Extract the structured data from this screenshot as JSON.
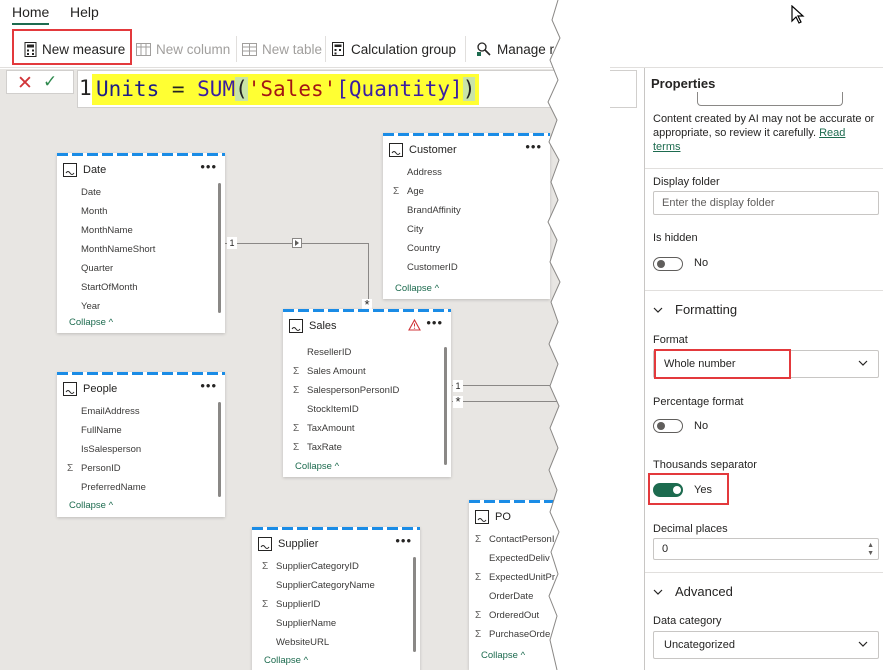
{
  "menu": {
    "tabs": [
      {
        "label": "Home",
        "active": true
      },
      {
        "label": "Help",
        "active": false
      }
    ]
  },
  "ribbon": {
    "new_measure": "New measure",
    "new_column": "New column",
    "new_table": "New table",
    "calculation_group": "Calculation group",
    "manage": "Manage r"
  },
  "formula": {
    "line_number": "1",
    "tokens": {
      "var": "Units",
      "eq": " = ",
      "fn": "SUM",
      "open": "(",
      "table": "'Sales'",
      "col": "[Quantity]",
      "close": ")"
    }
  },
  "tables": {
    "date": {
      "title": "Date",
      "fields": [
        {
          "name": "Date",
          "sigma": false
        },
        {
          "name": "Month",
          "sigma": false
        },
        {
          "name": "MonthName",
          "sigma": false
        },
        {
          "name": "MonthNameShort",
          "sigma": false
        },
        {
          "name": "Quarter",
          "sigma": false
        },
        {
          "name": "StartOfMonth",
          "sigma": false
        },
        {
          "name": "Year",
          "sigma": false
        }
      ],
      "collapse": "Collapse"
    },
    "customer": {
      "title": "Customer",
      "fields": [
        {
          "name": "Address",
          "sigma": false
        },
        {
          "name": "Age",
          "sigma": true
        },
        {
          "name": "BrandAffinity",
          "sigma": false
        },
        {
          "name": "City",
          "sigma": false
        },
        {
          "name": "Country",
          "sigma": false
        },
        {
          "name": "CustomerID",
          "sigma": false
        }
      ],
      "collapse": "Collapse"
    },
    "sales": {
      "title": "Sales",
      "fields": [
        {
          "name": "ResellerID",
          "sigma": false
        },
        {
          "name": "Sales Amount",
          "sigma": true
        },
        {
          "name": "SalespersonPersonID",
          "sigma": true
        },
        {
          "name": "StockItemID",
          "sigma": false
        },
        {
          "name": "TaxAmount",
          "sigma": true
        },
        {
          "name": "TaxRate",
          "sigma": true
        }
      ],
      "collapse": "Collapse"
    },
    "people": {
      "title": "People",
      "fields": [
        {
          "name": "EmailAddress",
          "sigma": false
        },
        {
          "name": "FullName",
          "sigma": false
        },
        {
          "name": "IsSalesperson",
          "sigma": false
        },
        {
          "name": "PersonID",
          "sigma": true
        },
        {
          "name": "PreferredName",
          "sigma": false
        }
      ],
      "collapse": "Collapse"
    },
    "supplier": {
      "title": "Supplier",
      "fields": [
        {
          "name": "SupplierCategoryID",
          "sigma": true
        },
        {
          "name": "SupplierCategoryName",
          "sigma": false
        },
        {
          "name": "SupplierID",
          "sigma": true
        },
        {
          "name": "SupplierName",
          "sigma": false
        },
        {
          "name": "WebsiteURL",
          "sigma": false
        }
      ],
      "collapse": "Collapse"
    },
    "po": {
      "title": "PO",
      "fields": [
        {
          "name": "ContactPersonI",
          "sigma": true
        },
        {
          "name": "ExpectedDeliv",
          "sigma": false
        },
        {
          "name": "ExpectedUnitPr",
          "sigma": true
        },
        {
          "name": "OrderDate",
          "sigma": false
        },
        {
          "name": "OrderedOut",
          "sigma": true
        },
        {
          "name": "PurchaseOrde",
          "sigma": true
        }
      ],
      "collapse": "Collapse"
    }
  },
  "relationships": {
    "one": "1",
    "many": "*"
  },
  "properties": {
    "title": "Properties",
    "ai_note": "Content created by AI may not be accurate or appropriate, so review it carefully.",
    "ai_link": "Read terms",
    "display_folder_label": "Display folder",
    "display_folder_placeholder": "Enter the display folder",
    "is_hidden_label": "Is hidden",
    "is_hidden_value": "No",
    "formatting_section": "Formatting",
    "format_label": "Format",
    "format_value": "Whole number",
    "percentage_label": "Percentage format",
    "percentage_value": "No",
    "thousands_label": "Thousands separator",
    "thousands_value": "Yes",
    "decimal_label": "Decimal places",
    "decimal_value": "0",
    "advanced_section": "Advanced",
    "data_category_label": "Data category",
    "data_category_value": "Uncategorized"
  },
  "colors": {
    "accent": "#1d6b4f",
    "highlight": "#e3393c",
    "formula_bg": "#ffff33",
    "card_dash": "#1a8ce6"
  }
}
